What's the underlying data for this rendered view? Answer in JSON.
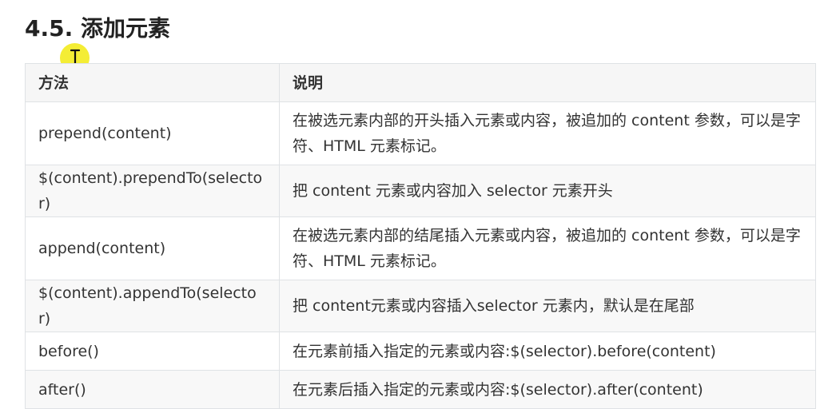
{
  "section": {
    "title": "4.5. 添加元素"
  },
  "cursor": {
    "icon": "text-cursor-icon",
    "highlight_color": "#f3ec2a"
  },
  "table": {
    "headers": [
      "方法",
      "说明"
    ],
    "rows": [
      {
        "method": "prepend(content)",
        "description": "在被选元素内部的开头插入元素或内容，被追加的 content 参数，可以是字符、HTML 元素标记。"
      },
      {
        "method": "$(content).prependTo(selector)",
        "description": "把 content 元素或内容加入 selector 元素开头"
      },
      {
        "method": "append(content)",
        "description": "在被选元素内部的结尾插入元素或内容，被追加的 content 参数，可以是字符、HTML 元素标记。"
      },
      {
        "method": "$(content).appendTo(selector)",
        "description": "把 content元素或内容插入selector 元素内，默认是在尾部"
      },
      {
        "method": "before()",
        "description": "在元素前插入指定的元素或内容:$(selector).before(content)"
      },
      {
        "method": "after()",
        "description": "在元素后插入指定的元素或内容:$(selector).after(content)"
      }
    ]
  }
}
